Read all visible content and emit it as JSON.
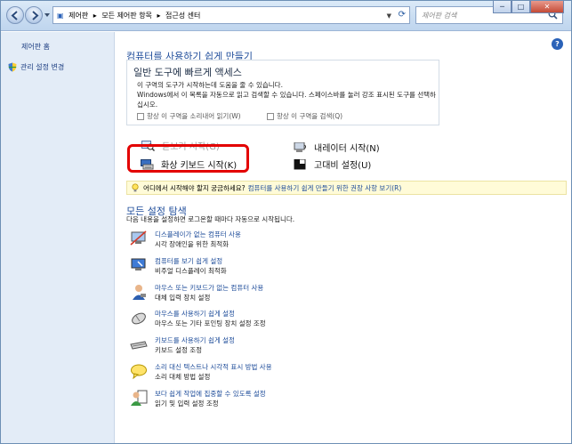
{
  "titlebar": {
    "breadcrumbs": [
      "제어판",
      "▸",
      "모든 제어판 항목",
      "▸",
      "접근성 센터"
    ],
    "search_placeholder": "제어판 검색",
    "controls": {
      "minimize": "─",
      "maximize": "□",
      "close": "✕"
    }
  },
  "sidebar": {
    "home": "제어판 홈",
    "change_admin": "관리 설정 변경"
  },
  "main": {
    "title": "컴퓨터를 사용하기 쉽게 만들기",
    "help": "?",
    "quick": {
      "heading": "일반 도구에 빠르게 액세스",
      "sub": "이 구역의 도구가 시작하는데 도움을 줄 수 있습니다.",
      "desc": "Windows에서 이 목록을 자동으로 읽고 검색할 수 있습니다. 스페이스바를 눌러 강조 표시된 도구를 선택하십시오.",
      "checkbox1": "항상 이 구역을 소리내어 읽기(W)",
      "checkbox2": "항상 이 구역을 검색(Q)"
    },
    "tools": {
      "magnifier": "돋보기 시작(G)",
      "narrator": "내레이터 시작(N)",
      "osk": "화상 키보드 시작(K)",
      "contrast": "고대비 설정(U)"
    },
    "tip": {
      "question": "어디에서 시작해야 할지 궁금하세요?",
      "link": "컴퓨터를 사용하기 쉽게 만들기 위한 권장 사항 보기(R)"
    },
    "explore": {
      "title": "모든 설정 탐색",
      "sub": "다음 내용을 설정하면 로그온할 때마다 자동으로 시작됩니다.",
      "items": [
        {
          "title": "디스플레이가 없는 컴퓨터 사용",
          "desc": "시각 장애인을 위한 최적화",
          "icon": "display-off-icon"
        },
        {
          "title": "컴퓨터를 보기 쉽게 설정",
          "desc": "비주얼 디스플레이 최적화",
          "icon": "monitor-icon"
        },
        {
          "title": "마우스 또는 키보드가 없는 컴퓨터 사용",
          "desc": "대체 입력 장치 설정",
          "icon": "person-icon"
        },
        {
          "title": "마우스를 사용하기 쉽게 설정",
          "desc": "마우스 또는 기타 포인팅 장치 설정 조정",
          "icon": "mouse-icon"
        },
        {
          "title": "키보드를 사용하기 쉽게 설정",
          "desc": "키보드 설정 조정",
          "icon": "keyboard-icon"
        },
        {
          "title": "소리 대신 텍스트나 시각적 표시 방법 사용",
          "desc": "소리 대체 방법 설정",
          "icon": "speech-bubble-icon"
        },
        {
          "title": "보다 쉽게 작업에 집중할 수 있도록 설정",
          "desc": "읽기 및 입력 설정 조정",
          "icon": "reading-icon"
        }
      ]
    }
  }
}
